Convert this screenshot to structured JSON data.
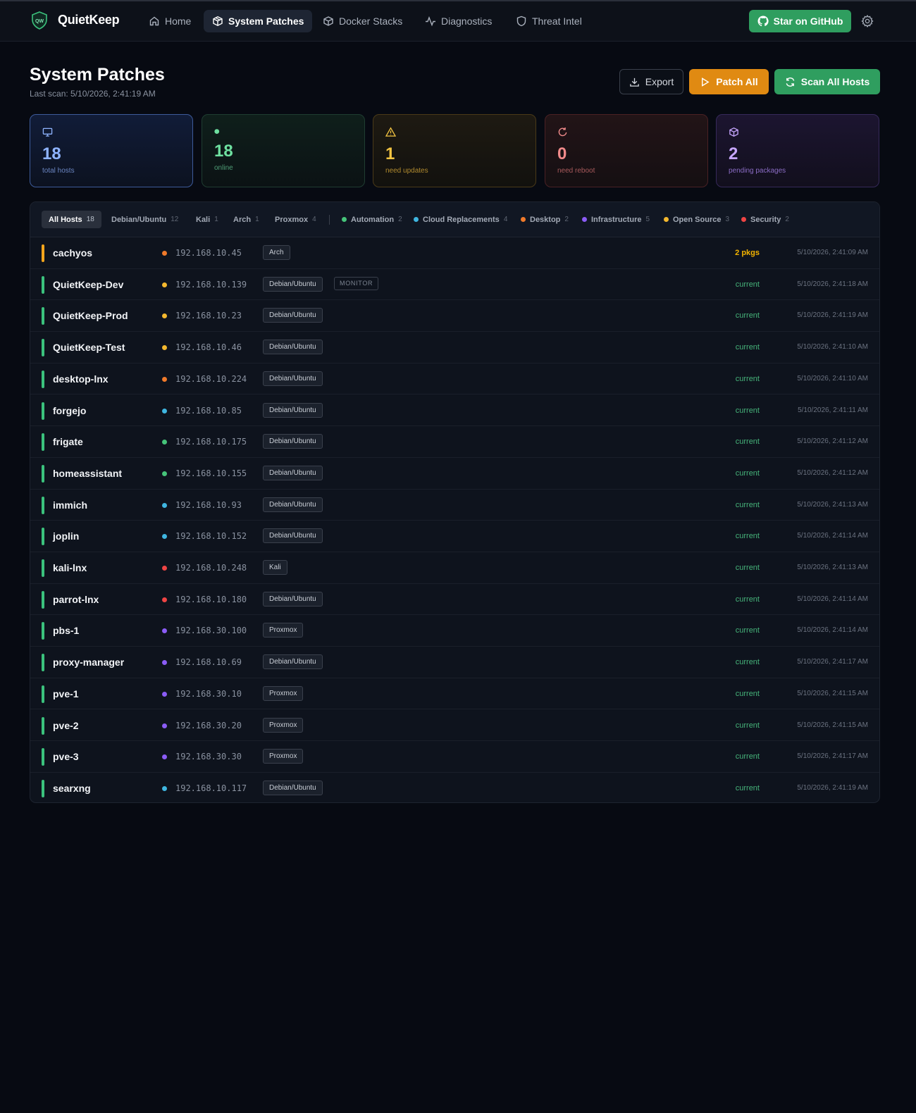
{
  "app": {
    "brand": "QuietKeep",
    "logo_text": "QW"
  },
  "nav": [
    {
      "label": "Home",
      "icon": "home-icon"
    },
    {
      "label": "System Patches",
      "icon": "package-icon",
      "active": true
    },
    {
      "label": "Docker Stacks",
      "icon": "box-icon"
    },
    {
      "label": "Diagnostics",
      "icon": "activity-icon"
    },
    {
      "label": "Threat Intel",
      "icon": "shield-icon"
    }
  ],
  "header": {
    "github_label": "Star on GitHub"
  },
  "page": {
    "title": "System Patches",
    "last_scan": "Last scan: 5/10/2026, 2:41:19 AM",
    "export_label": "Export",
    "patch_all_label": "Patch All",
    "scan_all_label": "Scan All Hosts"
  },
  "stats": [
    {
      "value": "18",
      "label": "total hosts",
      "icon": "monitor-icon",
      "color": "#8fb4ff"
    },
    {
      "value": "18",
      "label": "online",
      "icon": "online-dot-icon",
      "color": "#6ee0a0"
    },
    {
      "value": "1",
      "label": "need updates",
      "icon": "warning-icon",
      "color": "#f4c542"
    },
    {
      "value": "0",
      "label": "need reboot",
      "icon": "refresh-icon",
      "color": "#f08a8a"
    },
    {
      "value": "2",
      "label": "pending packages",
      "icon": "package-icon",
      "color": "#c7a6ff"
    }
  ],
  "filters": {
    "os": [
      {
        "label": "All Hosts",
        "count": "18",
        "active": true
      },
      {
        "label": "Debian/Ubuntu",
        "count": "12"
      },
      {
        "label": "Kali",
        "count": "1"
      },
      {
        "label": "Arch",
        "count": "1"
      },
      {
        "label": "Proxmox",
        "count": "4"
      }
    ],
    "groups": [
      {
        "label": "Automation",
        "count": "2",
        "color": "#46c47a"
      },
      {
        "label": "Cloud Replacements",
        "count": "4",
        "color": "#3fb6e0"
      },
      {
        "label": "Desktop",
        "count": "2",
        "color": "#f07a2a"
      },
      {
        "label": "Infrastructure",
        "count": "5",
        "color": "#8b5cf6"
      },
      {
        "label": "Open Source",
        "count": "3",
        "color": "#f4b82e"
      },
      {
        "label": "Security",
        "count": "2",
        "color": "#ef4444"
      }
    ]
  },
  "hosts": [
    {
      "name": "cachyos",
      "ip": "192.168.10.45",
      "os": "Arch",
      "status": "2 pkgs",
      "time": "5/10/2026, 2:41:09 AM",
      "dot": "#f07a2a",
      "bar": "#f4a51c"
    },
    {
      "name": "QuietKeep-Dev",
      "ip": "192.168.10.139",
      "os": "Debian/Ubuntu",
      "tag": "MONITOR",
      "status": "current",
      "time": "5/10/2026, 2:41:18 AM",
      "dot": "#f4b82e",
      "bar": "#3bc27d"
    },
    {
      "name": "QuietKeep-Prod",
      "ip": "192.168.10.23",
      "os": "Debian/Ubuntu",
      "status": "current",
      "time": "5/10/2026, 2:41:19 AM",
      "dot": "#f4b82e",
      "bar": "#3bc27d"
    },
    {
      "name": "QuietKeep-Test",
      "ip": "192.168.10.46",
      "os": "Debian/Ubuntu",
      "status": "current",
      "time": "5/10/2026, 2:41:10 AM",
      "dot": "#f4b82e",
      "bar": "#3bc27d"
    },
    {
      "name": "desktop-lnx",
      "ip": "192.168.10.224",
      "os": "Debian/Ubuntu",
      "status": "current",
      "time": "5/10/2026, 2:41:10 AM",
      "dot": "#f07a2a",
      "bar": "#3bc27d"
    },
    {
      "name": "forgejo",
      "ip": "192.168.10.85",
      "os": "Debian/Ubuntu",
      "status": "current",
      "time": "5/10/2026, 2:41:11 AM",
      "dot": "#3fb6e0",
      "bar": "#3bc27d"
    },
    {
      "name": "frigate",
      "ip": "192.168.10.175",
      "os": "Debian/Ubuntu",
      "status": "current",
      "time": "5/10/2026, 2:41:12 AM",
      "dot": "#46c47a",
      "bar": "#3bc27d"
    },
    {
      "name": "homeassistant",
      "ip": "192.168.10.155",
      "os": "Debian/Ubuntu",
      "status": "current",
      "time": "5/10/2026, 2:41:12 AM",
      "dot": "#46c47a",
      "bar": "#3bc27d"
    },
    {
      "name": "immich",
      "ip": "192.168.10.93",
      "os": "Debian/Ubuntu",
      "status": "current",
      "time": "5/10/2026, 2:41:13 AM",
      "dot": "#3fb6e0",
      "bar": "#3bc27d"
    },
    {
      "name": "joplin",
      "ip": "192.168.10.152",
      "os": "Debian/Ubuntu",
      "status": "current",
      "time": "5/10/2026, 2:41:14 AM",
      "dot": "#3fb6e0",
      "bar": "#3bc27d"
    },
    {
      "name": "kali-lnx",
      "ip": "192.168.10.248",
      "os": "Kali",
      "status": "current",
      "time": "5/10/2026, 2:41:13 AM",
      "dot": "#ef4444",
      "bar": "#3bc27d"
    },
    {
      "name": "parrot-lnx",
      "ip": "192.168.10.180",
      "os": "Debian/Ubuntu",
      "status": "current",
      "time": "5/10/2026, 2:41:14 AM",
      "dot": "#ef4444",
      "bar": "#3bc27d"
    },
    {
      "name": "pbs-1",
      "ip": "192.168.30.100",
      "os": "Proxmox",
      "status": "current",
      "time": "5/10/2026, 2:41:14 AM",
      "dot": "#8b5cf6",
      "bar": "#3bc27d"
    },
    {
      "name": "proxy-manager",
      "ip": "192.168.10.69",
      "os": "Debian/Ubuntu",
      "status": "current",
      "time": "5/10/2026, 2:41:17 AM",
      "dot": "#8b5cf6",
      "bar": "#3bc27d"
    },
    {
      "name": "pve-1",
      "ip": "192.168.30.10",
      "os": "Proxmox",
      "status": "current",
      "time": "5/10/2026, 2:41:15 AM",
      "dot": "#8b5cf6",
      "bar": "#3bc27d"
    },
    {
      "name": "pve-2",
      "ip": "192.168.30.20",
      "os": "Proxmox",
      "status": "current",
      "time": "5/10/2026, 2:41:15 AM",
      "dot": "#8b5cf6",
      "bar": "#3bc27d"
    },
    {
      "name": "pve-3",
      "ip": "192.168.30.30",
      "os": "Proxmox",
      "status": "current",
      "time": "5/10/2026, 2:41:17 AM",
      "dot": "#8b5cf6",
      "bar": "#3bc27d"
    },
    {
      "name": "searxng",
      "ip": "192.168.10.117",
      "os": "Debian/Ubuntu",
      "status": "current",
      "time": "5/10/2026, 2:41:19 AM",
      "dot": "#3fb6e0",
      "bar": "#3bc27d"
    }
  ]
}
